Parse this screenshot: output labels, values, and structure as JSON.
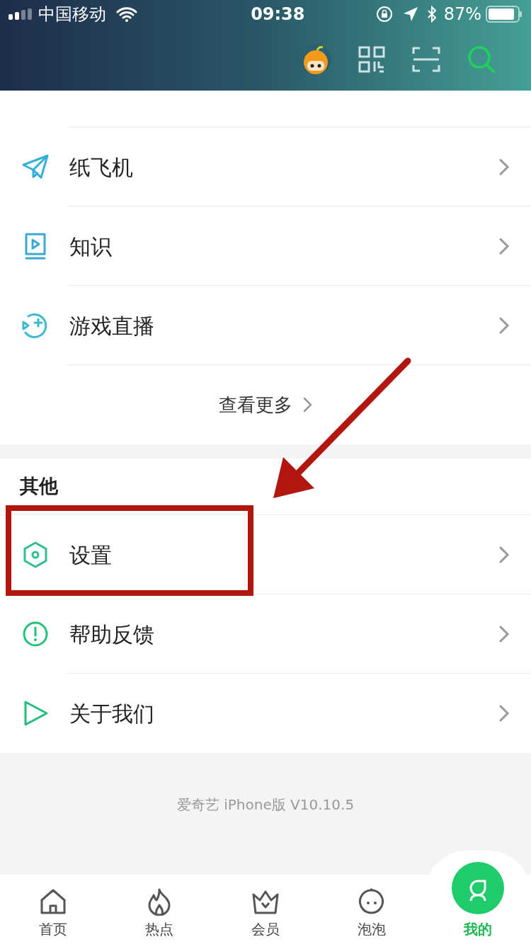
{
  "status_bar": {
    "carrier": "中国移动",
    "time": "09:38",
    "battery": "87%"
  },
  "sections": [
    {
      "items": [
        {
          "label": "纸飞机"
        },
        {
          "label": "知识"
        },
        {
          "label": "游戏直播"
        }
      ],
      "more": "查看更多"
    },
    {
      "title": "其他",
      "items": [
        {
          "label": "设置"
        },
        {
          "label": "帮助反馈"
        },
        {
          "label": "关于我们"
        }
      ]
    }
  ],
  "footer": "爱奇艺 iPhone版 V10.10.5",
  "tabs": [
    {
      "label": "首页",
      "selected": false
    },
    {
      "label": "热点",
      "selected": false
    },
    {
      "label": "会员",
      "selected": false
    },
    {
      "label": "泡泡",
      "selected": false
    },
    {
      "label": "我的",
      "selected": true
    }
  ]
}
